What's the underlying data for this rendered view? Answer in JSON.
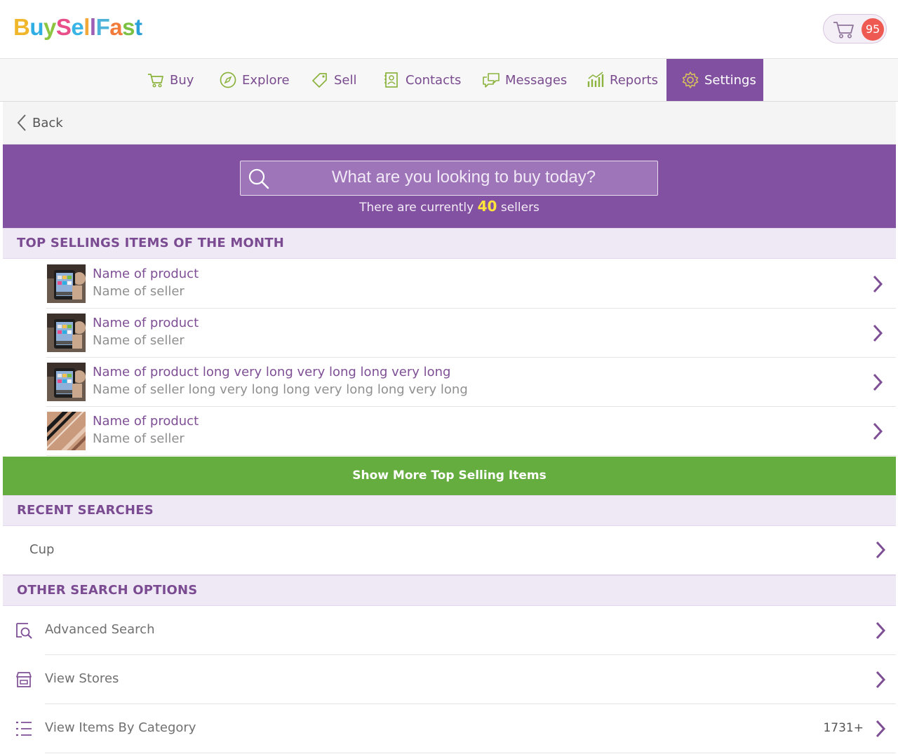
{
  "header": {
    "logo_text": "BuySellFast",
    "logo_colors": [
      "#f1b72c",
      "#2eaee3",
      "#8cc540",
      "#e84e8a",
      "#39b4e6",
      "#f3a93a",
      "#9c5fb5",
      "#4db3d8",
      "#f27b3c",
      "#7ac143",
      "#2a9fd8"
    ],
    "cart_count": "95"
  },
  "nav": {
    "items": [
      {
        "label": "Buy",
        "icon": "cart-icon"
      },
      {
        "label": "Explore",
        "icon": "compass-icon"
      },
      {
        "label": "Sell",
        "icon": "tag-icon"
      },
      {
        "label": "Contacts",
        "icon": "contacts-icon"
      },
      {
        "label": "Messages",
        "icon": "messages-icon"
      },
      {
        "label": "Reports",
        "icon": "chart-icon"
      },
      {
        "label": "Settings",
        "icon": "gear-icon"
      }
    ],
    "active": "Settings"
  },
  "back": {
    "label": "Back"
  },
  "search": {
    "placeholder": "What are you looking to buy today?",
    "count_prefix": "There are currently",
    "count_value": "40",
    "count_suffix": "sellers"
  },
  "top_selling": {
    "title": "TOP SELLINGS ITEMS OF THE MONTH",
    "items": [
      {
        "name": "Name of product",
        "seller": "Name of seller",
        "thumb": "tablet"
      },
      {
        "name": "Name of product",
        "seller": "Name of seller",
        "thumb": "tablet"
      },
      {
        "name": "Name of product long very long very long long very long",
        "seller": "Name of seller long very long long very long long very long",
        "thumb": "tablet"
      },
      {
        "name": "Name of product",
        "seller": "Name of seller",
        "thumb": "texture"
      }
    ],
    "show_more": "Show More Top Selling Items"
  },
  "recent": {
    "title": "RECENT SEARCHES",
    "items": [
      {
        "label": "Cup"
      }
    ]
  },
  "other": {
    "title": "OTHER SEARCH OPTIONS",
    "items": [
      {
        "label": "Advanced Search",
        "icon": "advanced-search-icon",
        "count": ""
      },
      {
        "label": "View Stores",
        "icon": "store-icon",
        "count": ""
      },
      {
        "label": "View Items By Category",
        "icon": "list-icon",
        "count": "1731+"
      }
    ]
  },
  "colors": {
    "brand_purple": "#8351a2",
    "accent_green": "#66ad3f",
    "badge_red": "#ee5a52",
    "highlight_yellow": "#ffe53b"
  }
}
